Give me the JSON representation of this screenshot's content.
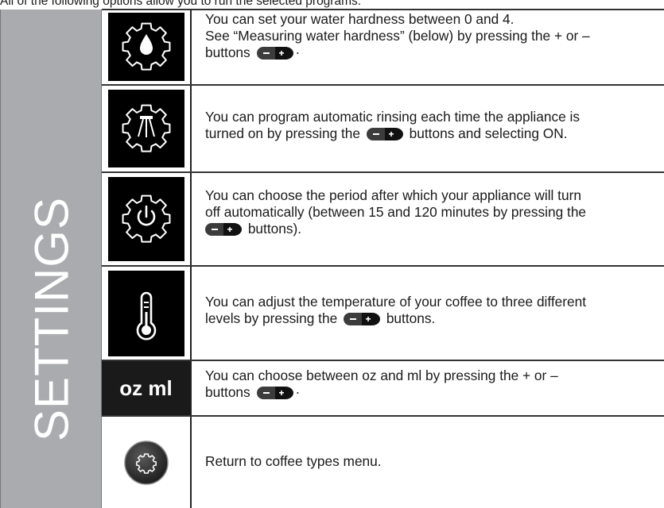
{
  "intro_text": "All of the following options allow you to run the selected programs.",
  "side_label": "SETTINGS",
  "rows": [
    {
      "icon": "water-hardness-gear-icon",
      "line1": "You can set your water hardness between 0 and 4.",
      "line2": "See “Measuring water hardness” (below) by pressing the + or –",
      "line3a": "buttons",
      "line3b": "·"
    },
    {
      "icon": "rinse-gear-icon",
      "line1": "You can program automatic rinsing each time the appliance is",
      "line2a": "turned on by pressing the",
      "line2b": "buttons and selecting ON."
    },
    {
      "icon": "power-gear-icon",
      "line1": "You can choose the period after which your appliance will turn",
      "line2": "off automatically (between 15 and 120 minutes by pressing the",
      "line3b": "buttons)."
    },
    {
      "icon": "thermometer-icon",
      "line1": "You can adjust the temperature of your coffee to three different",
      "line2a": "levels by pressing the",
      "line2b": "buttons."
    },
    {
      "icon_label": "oz ml",
      "line1": "You can choose between oz and ml by pressing the + or –",
      "line2a": "buttons",
      "line2b": "·"
    },
    {
      "icon": "settings-round-icon",
      "line1": "Return to coffee types menu."
    }
  ],
  "colors": {
    "sidebar": "#a9abae",
    "icon_bg": "#000000",
    "text": "#1a1a1a"
  }
}
